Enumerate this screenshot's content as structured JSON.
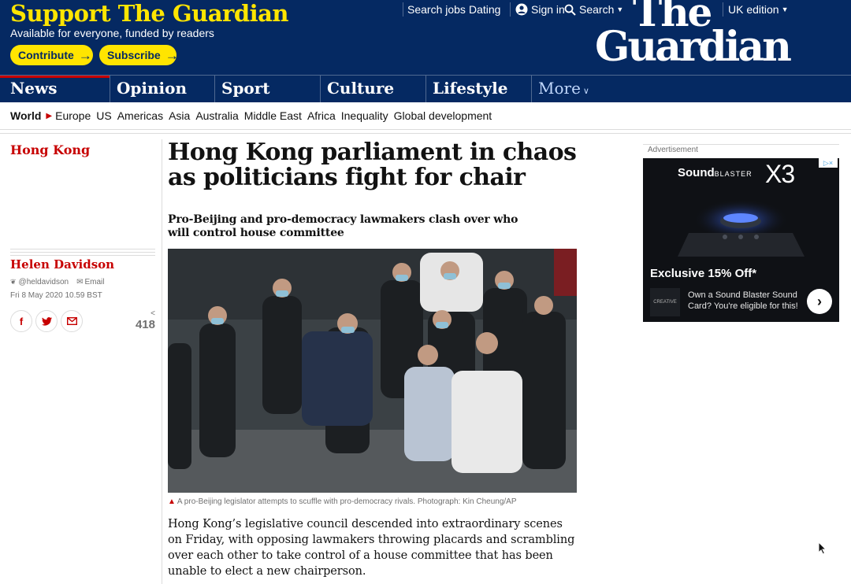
{
  "header": {
    "support_title": "Support The Guardian",
    "support_sub": "Available for everyone, funded by readers",
    "contribute_label": "Contribute",
    "subscribe_label": "Subscribe",
    "arrow": "→",
    "links": {
      "search_jobs": "Search jobs",
      "dating": "Dating",
      "sign_in": "Sign in",
      "search": "Search",
      "edition": "UK edition"
    },
    "logo_line1": "The",
    "logo_line2": "Guardian",
    "colors": {
      "brand_blue": "#052962",
      "brand_yellow": "#ffe500",
      "news_red": "#c70000"
    }
  },
  "pillars": {
    "news": "News",
    "opinion": "Opinion",
    "sport": "Sport",
    "culture": "Culture",
    "lifestyle": "Lifestyle",
    "more": "More"
  },
  "subnav": {
    "root": "World",
    "items": [
      "Europe",
      "US",
      "Americas",
      "Asia",
      "Australia",
      "Middle East",
      "Africa",
      "Inequality",
      "Global development"
    ]
  },
  "article": {
    "section": "Hong Kong",
    "headline": "Hong Kong parliament in chaos as politicians fight for chair",
    "standfirst": "Pro-Beijing and pro-democracy lawmakers clash over who will control house committee",
    "byline": "Helen Davidson",
    "twitter_handle": "@heldavidson",
    "email_label": "Email",
    "dateline": "Fri 8 May 2020 10.59 BST",
    "share_count": "418",
    "caption": "A pro-Beijing legislator attempts to scuffle with pro-democracy rivals. Photograph: Kin Cheung/AP",
    "body": "Hong Kong’s legislative council descended into extraordinary scenes on Friday, with opposing lawmakers throwing placards and scrambling over each other to take control of a house committee that has been unable to elect a new chairperson."
  },
  "share_icons": [
    "facebook-icon",
    "twitter-icon",
    "email-icon"
  ],
  "ad": {
    "label": "Advertisement",
    "brand": "Sound",
    "brand_small": "BLASTER",
    "model": "X3",
    "offer": "Exclusive 15% Off*",
    "creative": "CREATIVE",
    "copy": "Own a Sound Blaster Sound Card? You're eligible for this!"
  }
}
